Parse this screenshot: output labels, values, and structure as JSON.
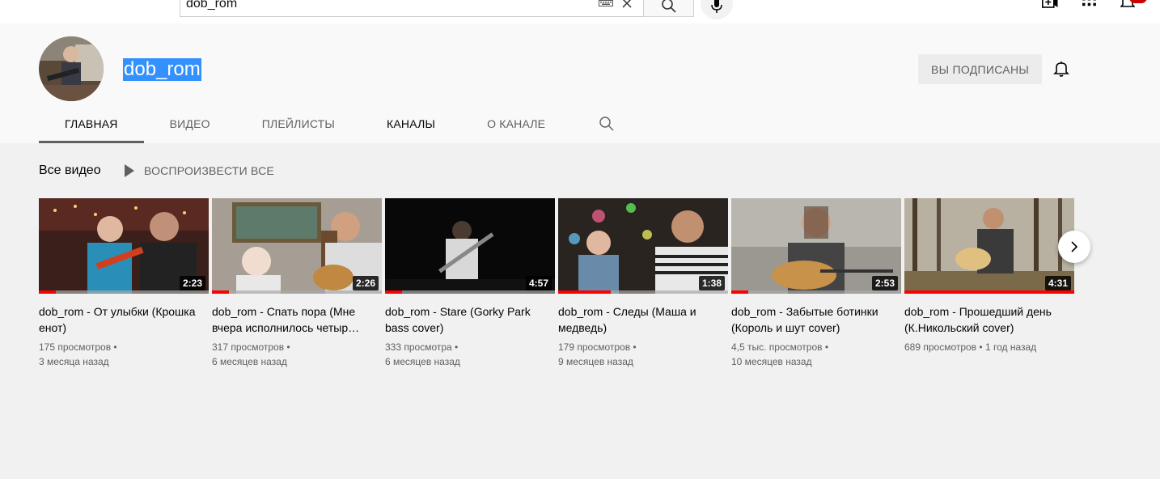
{
  "search": {
    "value": "dob_rom"
  },
  "channel": {
    "name": "dob_rom",
    "subscribe_label": "ВЫ ПОДПИСАНЫ"
  },
  "tabs": [
    {
      "label": "ГЛАВНАЯ"
    },
    {
      "label": "ВИДЕО"
    },
    {
      "label": "ПЛЕЙЛИСТЫ"
    },
    {
      "label": "КАНАЛЫ"
    },
    {
      "label": "О КАНАЛЕ"
    }
  ],
  "section": {
    "title": "Все видео",
    "play_all": "ВОСПРОИЗВЕСТИ ВСЕ"
  },
  "videos": [
    {
      "title": "dob_rom - От улыбки (Крошка енот)",
      "duration": "2:23",
      "views": "175 просмотров",
      "age": "3 месяца назад",
      "watched_fraction": 0.1
    },
    {
      "title": "dob_rom - Спать пора (Мне вчера исполнилось четыр…",
      "duration": "2:26",
      "views": "317 просмотров",
      "age": "6 месяцев назад",
      "watched_fraction": 0.1
    },
    {
      "title": "dob_rom - Stare (Gorky Park bass cover)",
      "duration": "4:57",
      "views": "333 просмотра",
      "age": "6 месяцев назад",
      "watched_fraction": 0.1
    },
    {
      "title": "dob_rom - Следы (Маша и медведь)",
      "duration": "1:38",
      "views": "179 просмотров",
      "age": "9 месяцев назад",
      "watched_fraction": 0.31
    },
    {
      "title": "dob_rom - Забытые ботинки (Король и шут cover)",
      "duration": "2:53",
      "views": "4,5 тыс. просмотров",
      "age": "10 месяцев назад",
      "watched_fraction": 0.1
    },
    {
      "title": "dob_rom - Прошедший день (К.Никольский cover)",
      "duration": "4:31",
      "views": "689 просмотров",
      "age": "1 год назад",
      "watched_fraction": 1.0
    }
  ],
  "colors": {
    "accent_red": "#ff0000",
    "selection_blue": "#3390ff"
  },
  "icons": [
    "keyboard-icon",
    "clear-icon",
    "search-icon",
    "mic-icon",
    "create-video-icon",
    "apps-icon",
    "notifications-icon",
    "bell-icon",
    "play-icon",
    "chevron-right-icon"
  ]
}
